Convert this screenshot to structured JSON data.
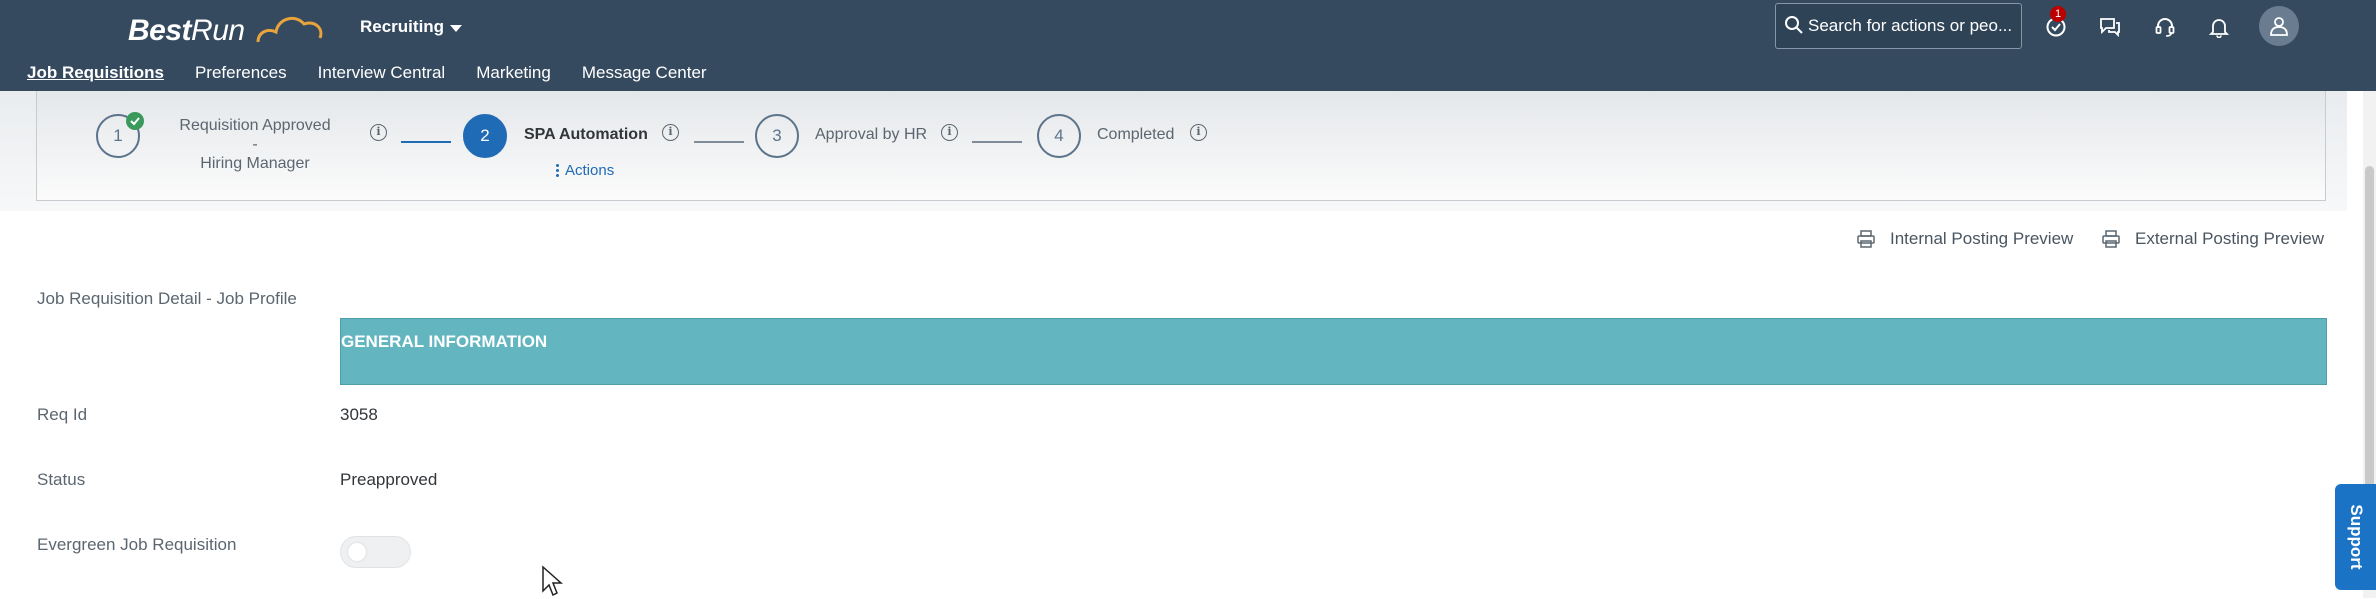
{
  "shell": {
    "logo_bold": "Best",
    "logo_light": "Run",
    "module_label": "Recruiting",
    "search_placeholder": "Search for actions or peo...",
    "todo_count": "1",
    "icons": [
      "todo-icon",
      "feedback-icon",
      "help-icon",
      "notifications-icon",
      "user-avatar-icon"
    ]
  },
  "tabs": [
    {
      "label": "Job Requisitions",
      "active": true
    },
    {
      "label": "Preferences"
    },
    {
      "label": "Interview Central"
    },
    {
      "label": "Marketing"
    },
    {
      "label": "Message Center"
    }
  ],
  "progress": {
    "steps": [
      {
        "number": "1",
        "label_line1": "Requisition Approved -",
        "label_line2": "Hiring Manager",
        "state": "completed"
      },
      {
        "number": "2",
        "label": "SPA Automation",
        "state": "current"
      },
      {
        "number": "3",
        "label": "Approval by HR",
        "state": "pending"
      },
      {
        "number": "4",
        "label": "Completed",
        "state": "pending"
      }
    ],
    "info_glyph": "i",
    "actions_label": "Actions"
  },
  "previews": {
    "internal": "Internal Posting Preview",
    "external": "External Posting Preview"
  },
  "form": {
    "section_title": "Job Requisition Detail - Job Profile",
    "section_header": "GENERAL INFORMATION",
    "fields": [
      {
        "label": "Req Id",
        "value": "3058"
      },
      {
        "label": "Status",
        "value": "Preapproved"
      },
      {
        "label": "Evergreen Job Requisition",
        "value": "off"
      }
    ]
  },
  "support_label": "Support",
  "colors": {
    "shell_bg": "#354a5f",
    "current_step": "#1f6bb5",
    "completed_check": "#3a9a5b",
    "section_header_bg": "#63b6c0",
    "support_tab": "#1a73c4",
    "badge": "#bb0000"
  }
}
